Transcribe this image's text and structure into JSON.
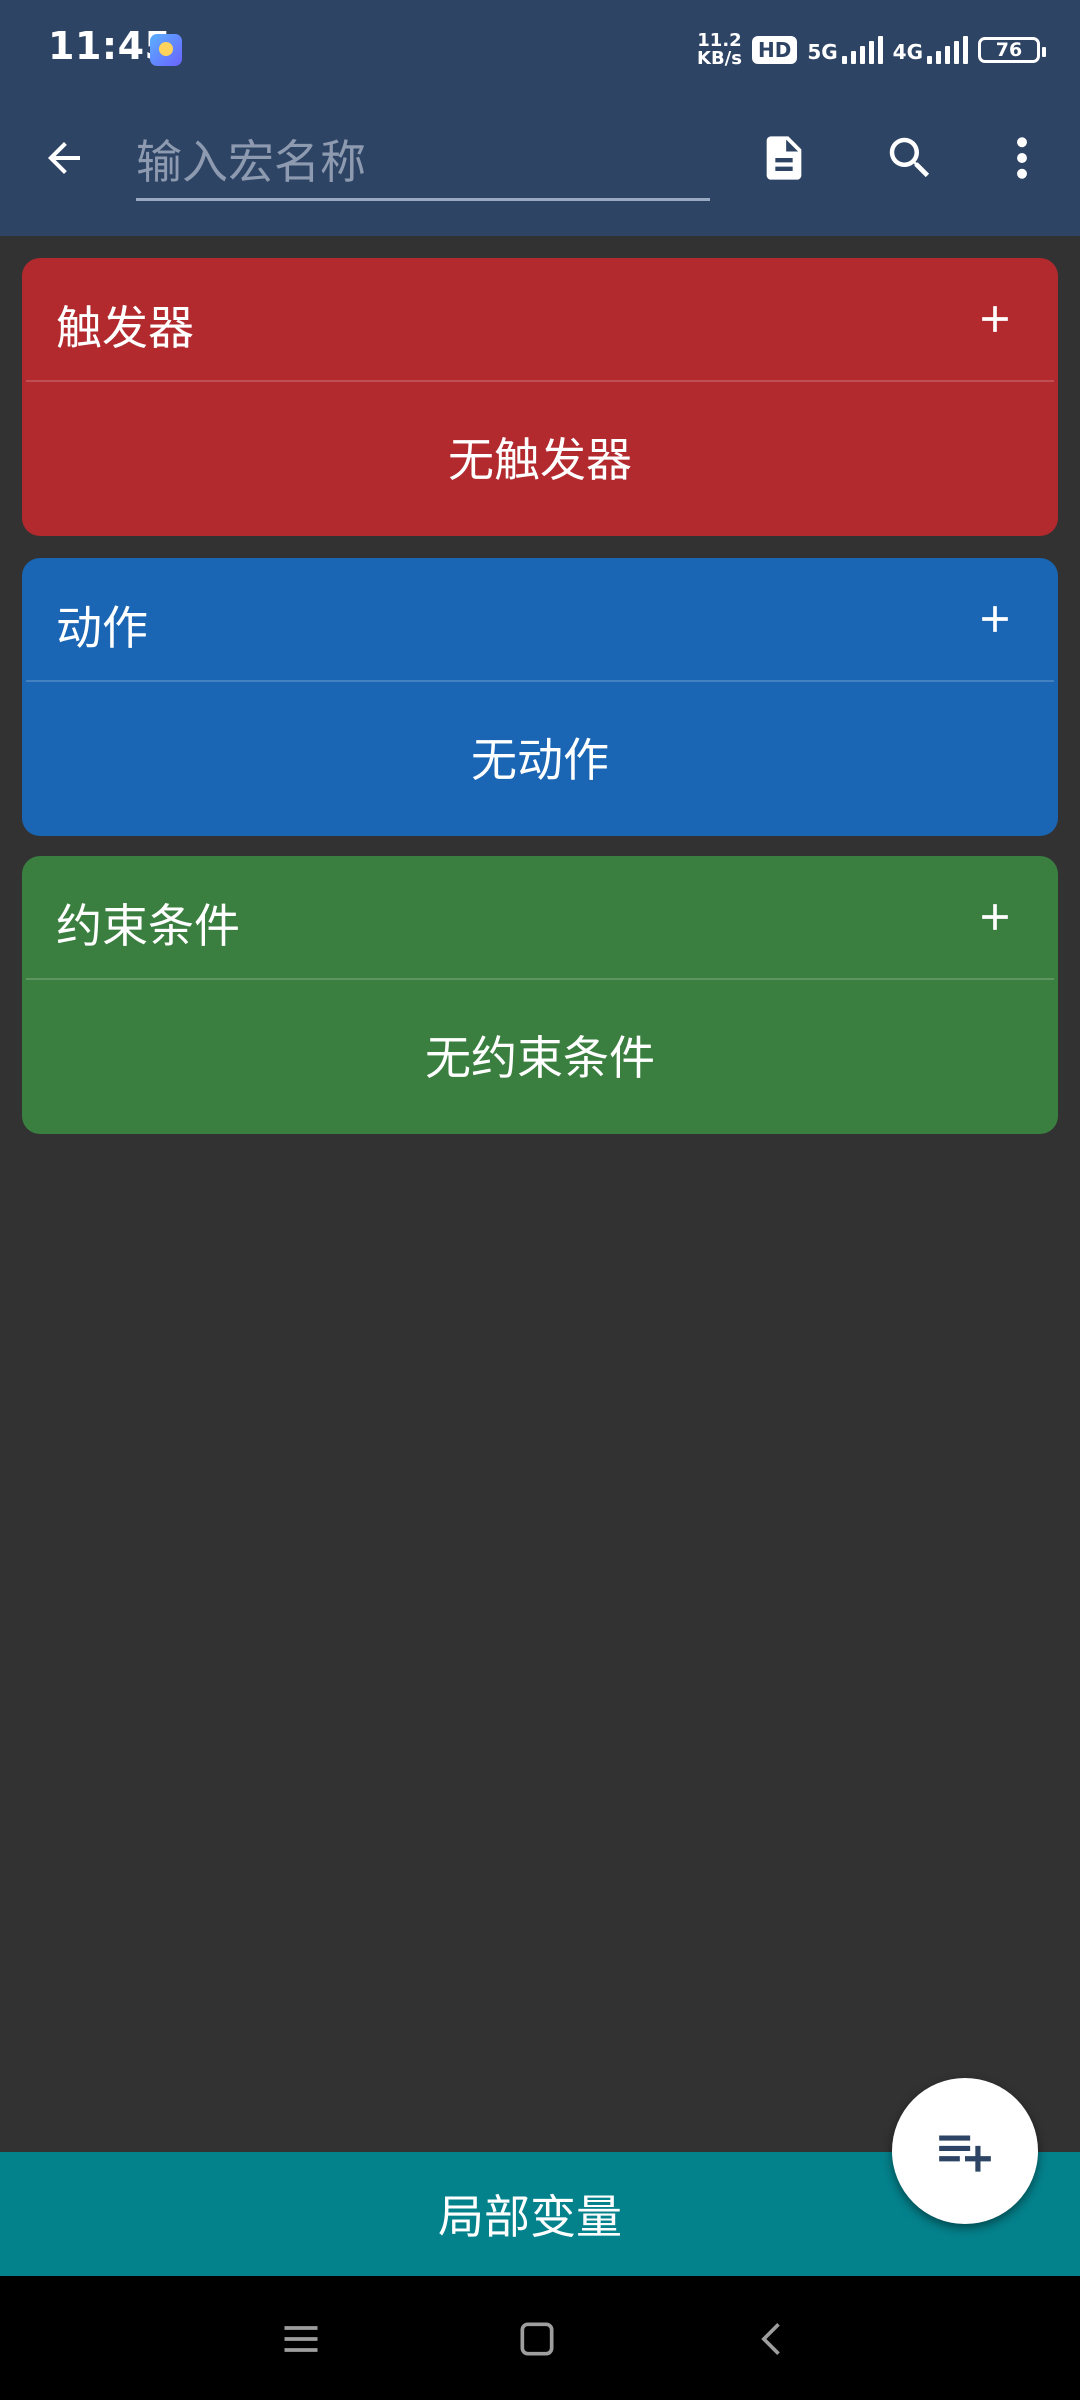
{
  "status_bar": {
    "time": "11:45",
    "net_speed_value": "11.2",
    "net_speed_unit": "KB/s",
    "hd_badge": "HD",
    "sim1_network": "5G",
    "sim2_network": "4G",
    "battery_level": "76"
  },
  "app_bar": {
    "name_placeholder": "输入宏名称",
    "name_value": ""
  },
  "sections": {
    "triggers": {
      "title": "触发器",
      "empty_text": "无触发器",
      "color": "#b2292e"
    },
    "actions": {
      "title": "动作",
      "empty_text": "无动作",
      "color": "#1a66b4"
    },
    "constraints": {
      "title": "约束条件",
      "empty_text": "无约束条件",
      "color": "#3a7f3f"
    }
  },
  "bottom_bar": {
    "label": "局部变量",
    "color": "#04828c"
  },
  "icons": {
    "back": "arrow-left-icon",
    "doc": "document-icon",
    "search": "search-icon",
    "more": "more-vert-icon",
    "add": "plus-icon",
    "fab": "playlist-add-icon",
    "nav_menu": "menu-icon",
    "nav_home": "home-square-icon",
    "nav_back": "chevron-left-icon"
  }
}
